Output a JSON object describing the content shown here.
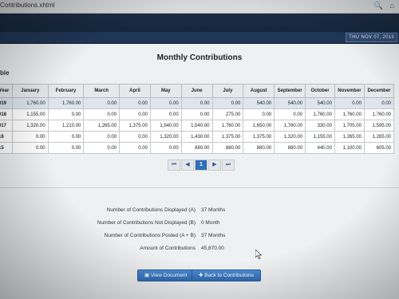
{
  "browser": {
    "url_text": "Contributions.xhtml",
    "icons": [
      "search-icon",
      "home-icon"
    ]
  },
  "header": {
    "date_text": "THU NOV 07, 2019"
  },
  "page": {
    "title": "Monthly Contributions",
    "section_label": "ble"
  },
  "table": {
    "columns": [
      "Year",
      "January",
      "February",
      "March",
      "April",
      "May",
      "June",
      "July",
      "August",
      "September",
      "October",
      "November",
      "December"
    ],
    "rows": [
      {
        "year": "019",
        "values": [
          "1,760.00",
          "1,760.00",
          "0.00",
          "0.00",
          "0.00",
          "0.00",
          "0.00",
          "540.00",
          "540.00",
          "540.00",
          "0.00",
          "0.00"
        ]
      },
      {
        "year": "018",
        "values": [
          "1,155.00",
          "0.00",
          "0.00",
          "0.00",
          "0.00",
          "0.00",
          "275.00",
          "0.00",
          "0.00",
          "1,760.00",
          "1,760.00",
          "1,760.00"
        ]
      },
      {
        "year": "017",
        "values": [
          "1,320.00",
          "1,210.00",
          "1,265.00",
          "1,375.00",
          "1,540.00",
          "1,540.00",
          "1,760.00",
          "1,650.00",
          "1,760.00",
          "330.00",
          "1,705.00",
          "1,595.00"
        ]
      },
      {
        "year": "16",
        "values": [
          "0.00",
          "0.00",
          "0.00",
          "0.00",
          "1,320.00",
          "1,430.00",
          "1,375.00",
          "1,375.00",
          "1,320.00",
          "1,155.00",
          "1,265.00",
          "1,265.00"
        ]
      },
      {
        "year": "15",
        "values": [
          "0.00",
          "0.00",
          "0.00",
          "0.00",
          "0.00",
          "880.00",
          "880.00",
          "880.00",
          "880.00",
          "440.00",
          "1,100.00",
          "605.00"
        ]
      }
    ]
  },
  "pager": {
    "first": "⏮",
    "prev": "◀",
    "current": "1",
    "next": "▶",
    "last": "⏭"
  },
  "summary": [
    {
      "label": "Number of Contributions Displayed (A)",
      "value": "37 Months"
    },
    {
      "label": "Number of Contributions Not Displayed (B)",
      "value": "0 Month"
    },
    {
      "label": "Number of Contributions Posted (A + B)",
      "value": "37 Months"
    },
    {
      "label": "Amount of Contributions",
      "value": "45,870.00"
    }
  ],
  "buttons": {
    "view": "View Document",
    "back": "Back to Contributions"
  },
  "colors": {
    "header": "#1b2c44",
    "accent": "#2f6fb6"
  }
}
